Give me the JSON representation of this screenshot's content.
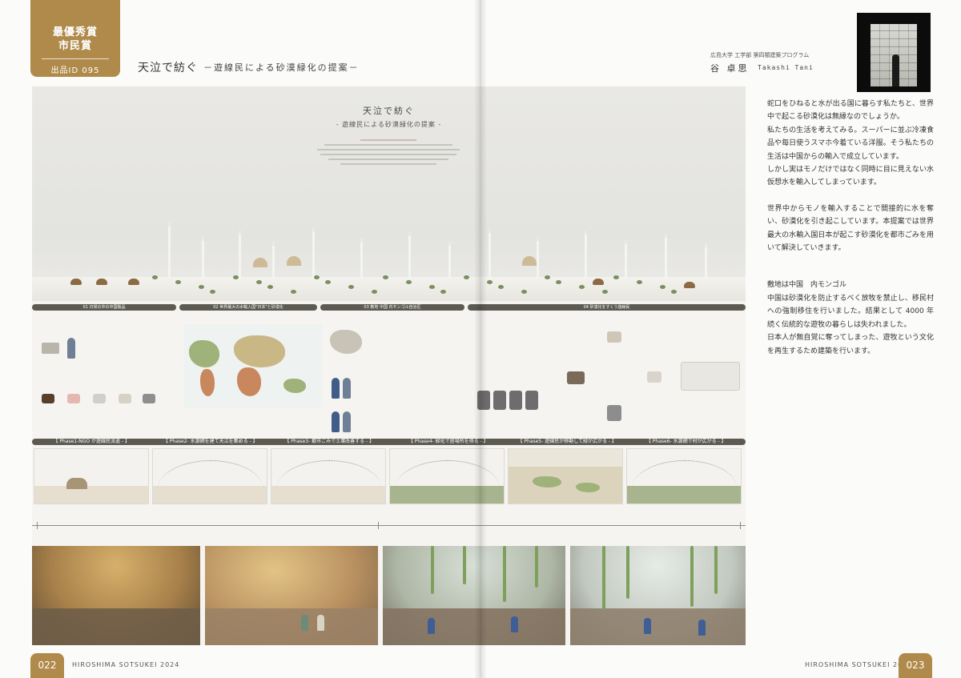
{
  "award": {
    "line1": "最優秀賞",
    "line2": "市民賞",
    "entry_id": "出品ID 095"
  },
  "header": {
    "title": "天泣で紡ぐ",
    "subtitle": "－遊線民による砂漠緑化の提案－"
  },
  "author": {
    "affiliation": "広島大学 工学部 第四類建築プログラム",
    "name_jp": "谷 卓思",
    "name_en": "Takashi Tani"
  },
  "panel": {
    "hero_title": "天泣で紡ぐ",
    "hero_subtitle": "- 遊線民による砂漠緑化の提案 -",
    "section_headers": [
      "01 日常の中の中国製品",
      "02 世界最大の水輸入国\"日本\"と砂漠化",
      "03 敷地 中国 内モンゴル自治区",
      "04 砂漠化をすくう遊線民"
    ],
    "phases": [
      "【 Phase1-NGO が遊線民派遣 - 】",
      "【 Phase2- 水源網を建て天泣を集める - 】",
      "【 Phase3- 都市ごみで土壌改善する - 】",
      "【 Phase4- 緑化で居場所を得る - 】",
      "【 Phase5- 遊線民が移動して緑が広がる - 】",
      "【 Phase6- 水源網で村が広がる - 】"
    ]
  },
  "body": {
    "paragraphs": [
      "蛇口をひねると水が出る国に暮らす私たちと、世界中で起こる砂漠化は無縁なのでしょうか。\n私たちの生活を考えてみる。スーパーに並ぶ冷凍食品や毎日使うスマホ今着ている洋服。そう私たちの生活は中国からの輸入で成立しています。\nしかし実はモノだけではなく同時に目に見えない水仮想水を輸入してしまっています。",
      "世界中からモノを輸入することで間接的に水を奪い、砂漠化を引き起こしています。本提案では世界最大の水輸入国日本が起こす砂漠化を都市ごみを用いて解決していきます。",
      "敷地は中国　内モンゴル\n中国は砂漠化を防止するべく放牧を禁止し、移民村への強制移住を行いました。結果として 4000 年続く伝統的な遊牧の暮らしは失われました。\n日本人が無自覚に奪ってしまった、遊牧という文化を再生するため建築を行います。"
    ]
  },
  "footer": {
    "page_left": "022",
    "page_right": "023",
    "event": "HIROSHIMA SOTSUKEI 2024"
  }
}
